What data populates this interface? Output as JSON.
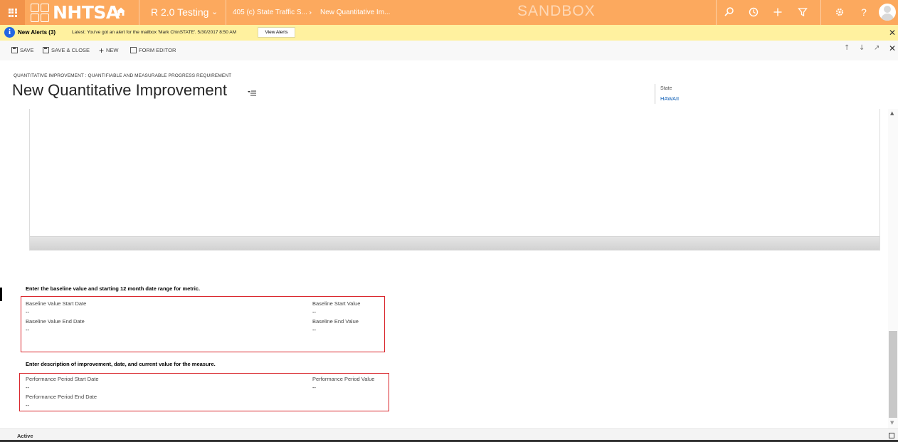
{
  "topbar": {
    "logo_text": "NHTSA",
    "app_name": "R 2.0 Testing",
    "breadcrumb_1": "405 (c) State Traffic S...",
    "breadcrumb_2": "New Quantitative Im...",
    "environment": "SANDBOX",
    "icons": [
      "search-icon",
      "recent-icon",
      "plus-icon",
      "filter-icon",
      "gear-icon",
      "help-icon",
      "user-avatar"
    ],
    "accent": "#fca95e"
  },
  "alert": {
    "title": "New Alerts (3)",
    "message": "Latest: You've got an alert for the mailbox 'Mark ChinSTATE'. 5/30/2017 8:50 AM",
    "button_label": "View Alerts"
  },
  "commands": {
    "save": "SAVE",
    "save_close": "SAVE & CLOSE",
    "new": "NEW",
    "form_editor": "FORM EDITOR"
  },
  "header": {
    "entity_label": "QUANTITATIVE IMPROVEMENT : QUANTIFIABLE AND MEASURABLE PROGRESS REQUIREMENT",
    "title": "New Quantitative Improvement",
    "state_label": "State",
    "state_value": "HAWAII"
  },
  "baseline": {
    "heading": "Enter the baseline value and starting 12 month date range for metric.",
    "start_date_label": "Baseline Value Start Date",
    "start_date_value": "--",
    "end_date_label": "Baseline Value End Date",
    "end_date_value": "--",
    "start_value_label": "Baseline Start Value",
    "start_value_value": "--",
    "end_value_label": "Baseline End Value",
    "end_value_value": "--"
  },
  "performance": {
    "heading": "Enter description of improvement, date, and current value for the measure.",
    "start_date_label": "Performance Period Start Date",
    "start_date_value": "--",
    "end_date_label": "Performance Period End Date",
    "end_date_value": "--",
    "value_label": "Performance Period Value",
    "value_value": "--"
  },
  "status": {
    "text": "Active"
  }
}
